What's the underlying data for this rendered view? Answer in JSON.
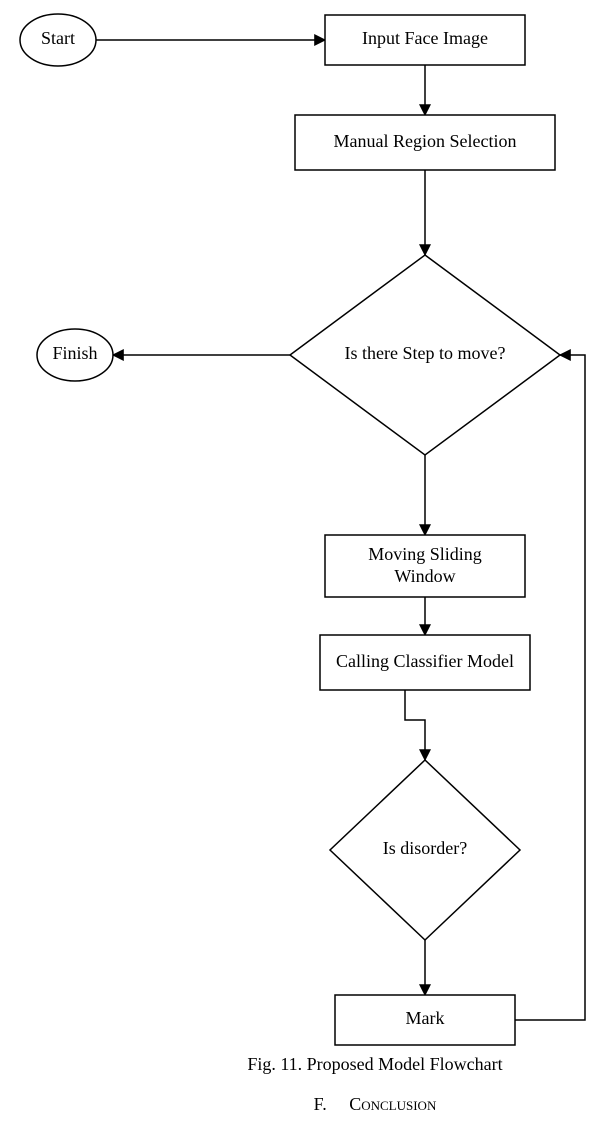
{
  "nodes": {
    "start": "Start",
    "input": "Input Face Image",
    "manual": "Manual Region Selection",
    "stepDecision": "Is there Step to move?",
    "finish": "Finish",
    "sliding": [
      "Moving Sliding",
      "Window"
    ],
    "classifier": "Calling Classifier Model",
    "disorderDecision": "Is disorder?",
    "mark": "Mark"
  },
  "caption": "Fig. 11. Proposed Model Flowchart",
  "section": {
    "letter": "F.",
    "title": "Conclusion"
  }
}
